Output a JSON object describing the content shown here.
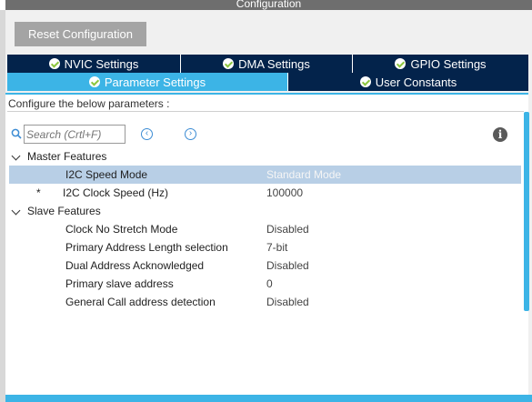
{
  "window": {
    "title": "Configuration"
  },
  "toolbar": {
    "reset_label": "Reset Configuration"
  },
  "tabs_row1": [
    {
      "label": "NVIC Settings"
    },
    {
      "label": "DMA Settings"
    },
    {
      "label": "GPIO Settings"
    }
  ],
  "tabs_row2": [
    {
      "label": "Parameter Settings",
      "active": true
    },
    {
      "label": "User Constants"
    }
  ],
  "description": "Configure the below parameters :",
  "search": {
    "placeholder": "Search (Crtl+F)"
  },
  "groups": [
    {
      "name": "Master Features",
      "params": [
        {
          "name": "I2C Speed Mode",
          "value": "Standard Mode",
          "selected": true
        },
        {
          "name": "I2C Clock Speed (Hz)",
          "value": "100000",
          "marker": "*"
        }
      ]
    },
    {
      "name": "Slave Features",
      "params": [
        {
          "name": "Clock No Stretch Mode",
          "value": "Disabled"
        },
        {
          "name": "Primary Address Length selection",
          "value": "7-bit"
        },
        {
          "name": "Dual Address Acknowledged",
          "value": "Disabled"
        },
        {
          "name": "Primary slave address",
          "value": "0"
        },
        {
          "name": "General Call address detection",
          "value": "Disabled"
        }
      ]
    }
  ],
  "colors": {
    "tab_dark": "#03234b",
    "tab_active": "#3cb4e6",
    "selected_row": "#b8cfe6",
    "check_green": "#8cc63f"
  }
}
